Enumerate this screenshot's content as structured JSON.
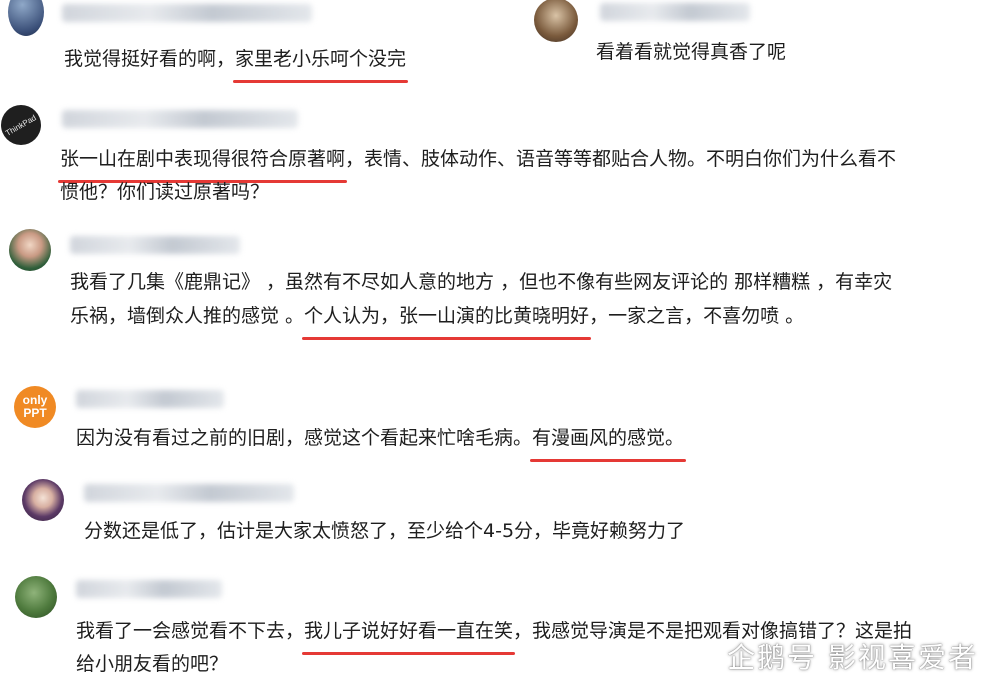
{
  "comments": [
    {
      "id": "c1",
      "text_plain_before": "我觉得挺好看的啊，",
      "text_highlight": "家里老小乐呵个没完"
    },
    {
      "id": "c2",
      "text_plain_before": "看着看就觉得真香了呢"
    },
    {
      "id": "c3",
      "avatar_label": "ThinkPad",
      "line1_highlight": "张一山在剧中表现得很符合原著啊",
      "line1_after": "，表情、肢体动作、语音等等都贴合人物。不明白你们为什么看不",
      "line2": "惯他？你们读过原著吗？"
    },
    {
      "id": "c4",
      "line1": "我看了几集《鹿鼎记》 ，虽然有不尽如人意的地方 ，但也不像有些网友评论的 那样糟糕 ，有幸灾",
      "line2_before": "乐祸，墙倒众人推的感觉 。",
      "line2_highlight": "个人认为，张一山演的比黄晓明好",
      "line2_after": "，一家之言，不喜勿喷 。"
    },
    {
      "id": "c5",
      "avatar_line1": "only",
      "avatar_line2": "PPT",
      "text_plain_before": "因为没有看过之前的旧剧，感觉这个看起来忙啥毛病。",
      "text_highlight": "有漫画风的感觉。"
    },
    {
      "id": "c6",
      "text_plain_before": "分数还是低了，估计是大家太愤怒了，至少给个4-5分，毕竟好赖努力了"
    },
    {
      "id": "c7",
      "line1_before": "我看了一会感觉看不下去，",
      "line1_highlight": "我儿子说好好看一直在笑",
      "line1_after": "，我感觉导演是不是把观看对像搞错了？这是拍",
      "line2": "给小朋友看的吧？"
    }
  ],
  "watermark": {
    "text": "企鹅号 影视喜爱者"
  },
  "colors": {
    "underline": "#e53935",
    "text": "#1e1e1e"
  }
}
